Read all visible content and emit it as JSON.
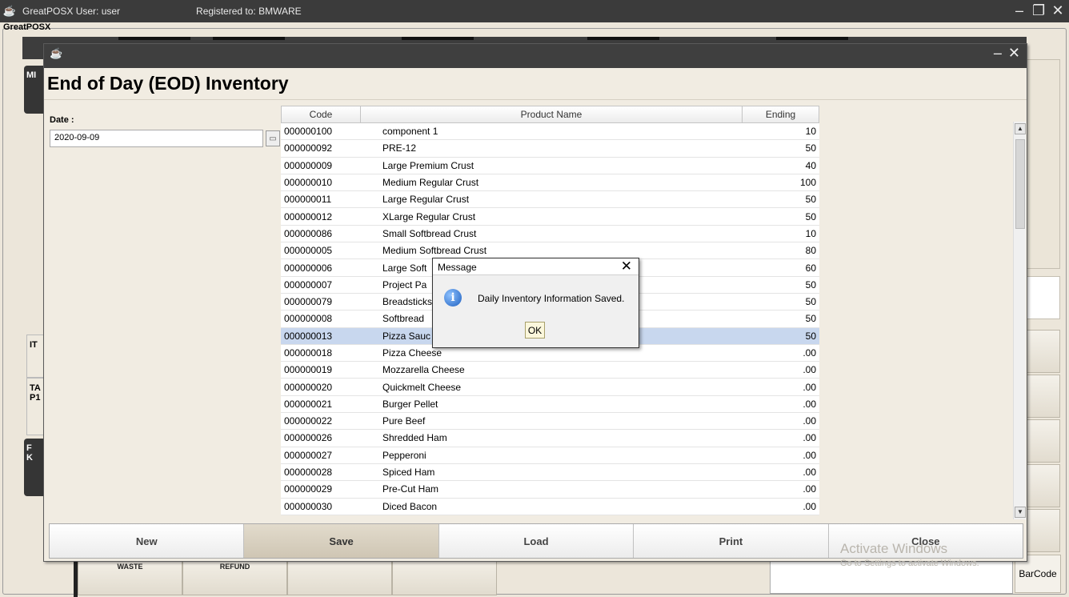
{
  "app": {
    "title_user": "GreatPOSX  User: user",
    "registered": "Registered to:  BMWARE",
    "menu_label": "GreatPOSX"
  },
  "background": {
    "left_tabs": [
      "MI",
      "IT",
      "TA\nP1",
      "F\nK"
    ],
    "bottom_buttons": [
      "WASTE",
      "REFUND",
      "",
      ""
    ],
    "barcode_label": "BarCode"
  },
  "dialog": {
    "title": "End of Day (EOD) Inventory",
    "date_label": "Date :",
    "date_value": "2020-09-09",
    "columns": {
      "code": "Code",
      "name": "Product Name",
      "ending": "Ending"
    },
    "rows": [
      {
        "code": "000000100",
        "name": "component 1",
        "ending": "10"
      },
      {
        "code": "000000092",
        "name": "PRE-12",
        "ending": "50"
      },
      {
        "code": "000000009",
        "name": "Large Premium Crust",
        "ending": "40"
      },
      {
        "code": "000000010",
        "name": "Medium Regular Crust",
        "ending": "100"
      },
      {
        "code": "000000011",
        "name": "Large Regular Crust",
        "ending": "50"
      },
      {
        "code": "000000012",
        "name": "XLarge Regular Crust",
        "ending": "50"
      },
      {
        "code": "000000086",
        "name": "Small Softbread Crust",
        "ending": "10"
      },
      {
        "code": "000000005",
        "name": "Medium Softbread Crust",
        "ending": "80"
      },
      {
        "code": "000000006",
        "name": "Large Soft",
        "ending": "60"
      },
      {
        "code": "000000007",
        "name": "Project Pa",
        "ending": "50"
      },
      {
        "code": "000000079",
        "name": "Breadsticks",
        "ending": "50"
      },
      {
        "code": "000000008",
        "name": "Softbread",
        "ending": "50"
      },
      {
        "code": "000000013",
        "name": "Pizza Sauc",
        "ending": "50",
        "selected": true
      },
      {
        "code": "000000018",
        "name": "Pizza Cheese",
        "ending": ".00"
      },
      {
        "code": "000000019",
        "name": "Mozzarella Cheese",
        "ending": ".00"
      },
      {
        "code": "000000020",
        "name": "Quickmelt Cheese",
        "ending": ".00"
      },
      {
        "code": "000000021",
        "name": "Burger Pellet",
        "ending": ".00"
      },
      {
        "code": "000000022",
        "name": "Pure Beef",
        "ending": ".00"
      },
      {
        "code": "000000026",
        "name": "Shredded Ham",
        "ending": ".00"
      },
      {
        "code": "000000027",
        "name": "Pepperoni",
        "ending": ".00"
      },
      {
        "code": "000000028",
        "name": "Spiced Ham",
        "ending": ".00"
      },
      {
        "code": "000000029",
        "name": "Pre-Cut Ham",
        "ending": ".00"
      },
      {
        "code": "000000030",
        "name": "Diced Bacon",
        "ending": ".00"
      }
    ],
    "buttons": {
      "new": "New",
      "save": "Save",
      "load": "Load",
      "print": "Print",
      "close": "Close"
    }
  },
  "message": {
    "title": "Message",
    "text": "Daily Inventory Information Saved.",
    "ok": "OK",
    "icon": "info-icon"
  },
  "watermark": {
    "line1": "Activate Windows",
    "line2": "Go to Settings to activate Windows."
  },
  "colors": {
    "titlebar": "#3b3b3b",
    "selected_row": "#c8d7ee",
    "dialog_bg": "#f1ece2"
  }
}
